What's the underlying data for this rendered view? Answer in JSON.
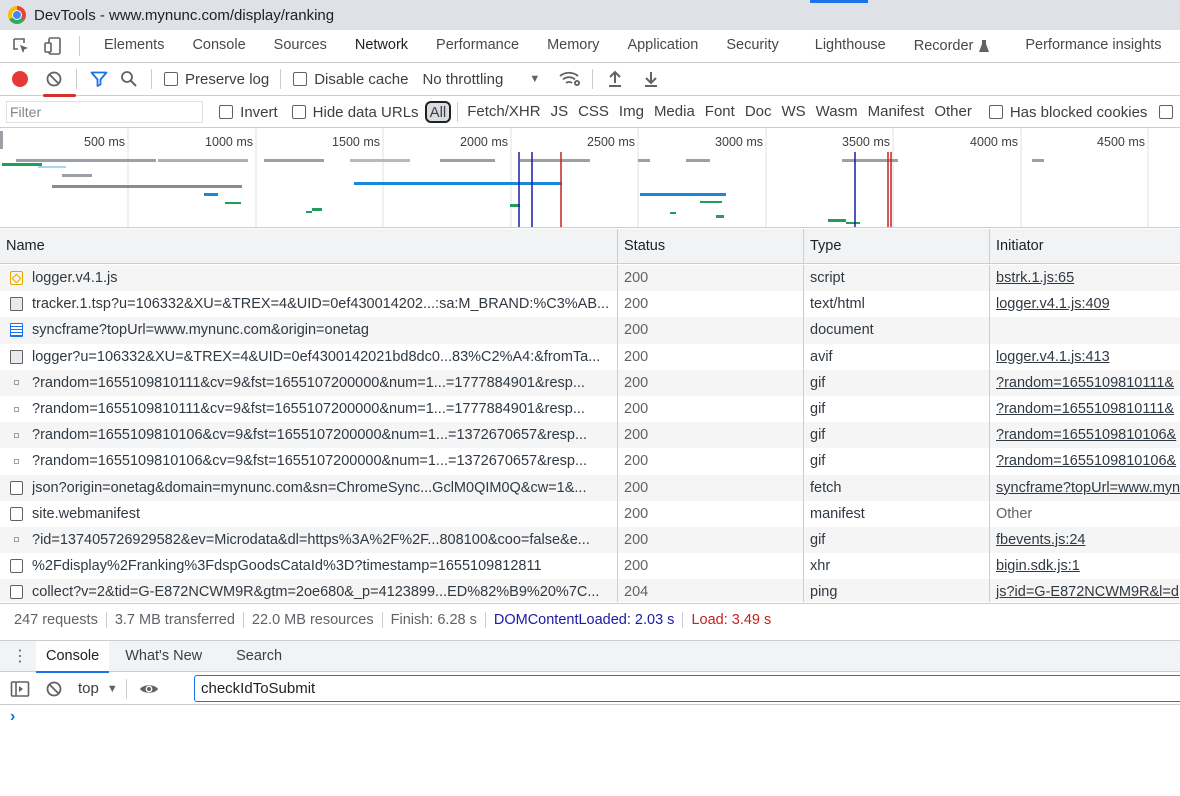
{
  "window": {
    "title": "DevTools - www.mynunc.com/display/ranking"
  },
  "tabs": [
    "Elements",
    "Console",
    "Sources",
    "Network",
    "Performance",
    "Memory",
    "Application",
    "Security",
    "Lighthouse",
    "Recorder",
    "Performance insights"
  ],
  "active_tab": "Network",
  "toolbar": {
    "preserve_log": "Preserve log",
    "disable_cache": "Disable cache",
    "throttling": "No throttling"
  },
  "filterbar": {
    "placeholder": "Filter",
    "invert": "Invert",
    "hide_data_urls": "Hide data URLs",
    "types": [
      "All",
      "Fetch/XHR",
      "JS",
      "CSS",
      "Img",
      "Media",
      "Font",
      "Doc",
      "WS",
      "Wasm",
      "Manifest",
      "Other"
    ],
    "selected_type": "All",
    "has_blocked_cookies": "Has blocked cookies"
  },
  "overview": {
    "ticks": [
      "500 ms",
      "1000 ms",
      "1500 ms",
      "2000 ms",
      "2500 ms",
      "3000 ms",
      "3500 ms",
      "4000 ms",
      "4500 ms"
    ]
  },
  "columns": {
    "name": "Name",
    "status": "Status",
    "type": "Type",
    "initiator": "Initiator"
  },
  "requests": [
    {
      "icon": "script",
      "name": "logger.v4.1.js",
      "status": "200",
      "type": "script",
      "initiator": "bstrk.1.js:65",
      "init_link": true
    },
    {
      "icon": "img",
      "name": "tracker.1.tsp?u=106332&XU=&TREX=4&UID=0ef430014202...:sa:M_BRAND:%C3%AB...",
      "status": "200",
      "type": "text/html",
      "initiator": "logger.v4.1.js:409",
      "init_link": true
    },
    {
      "icon": "doc",
      "name": "syncframe?topUrl=www.mynunc.com&origin=onetag",
      "status": "200",
      "type": "document",
      "initiator": "",
      "init_link": false
    },
    {
      "icon": "img",
      "name": "logger?u=106332&XU=&TREX=4&UID=0ef4300142021bd8dc0...83%C2%A4:&fromTa...",
      "status": "200",
      "type": "avif",
      "initiator": "logger.v4.1.js:413",
      "init_link": true
    },
    {
      "icon": "small",
      "name": "?random=1655109810111&cv=9&fst=1655107200000&num=1...=1777884901&resp...",
      "status": "200",
      "type": "gif",
      "initiator": "?random=1655109810111&",
      "init_link": true
    },
    {
      "icon": "small",
      "name": "?random=1655109810111&cv=9&fst=1655107200000&num=1...=1777884901&resp...",
      "status": "200",
      "type": "gif",
      "initiator": "?random=1655109810111&",
      "init_link": true
    },
    {
      "icon": "small",
      "name": "?random=1655109810106&cv=9&fst=1655107200000&num=1...=1372670657&resp...",
      "status": "200",
      "type": "gif",
      "initiator": "?random=1655109810106&",
      "init_link": true
    },
    {
      "icon": "small",
      "name": "?random=1655109810106&cv=9&fst=1655107200000&num=1...=1372670657&resp...",
      "status": "200",
      "type": "gif",
      "initiator": "?random=1655109810106&",
      "init_link": true
    },
    {
      "icon": "generic",
      "name": "json?origin=onetag&domain=mynunc.com&sn=ChromeSync...GclM0QIM0Q&cw=1&...",
      "status": "200",
      "type": "fetch",
      "initiator": "syncframe?topUrl=www.myn",
      "init_link": true
    },
    {
      "icon": "generic",
      "name": "site.webmanifest",
      "status": "200",
      "type": "manifest",
      "initiator": "Other",
      "init_link": false
    },
    {
      "icon": "small",
      "name": "?id=137405726929582&ev=Microdata&dl=https%3A%2F%2F...808100&coo=false&e...",
      "status": "200",
      "type": "gif",
      "initiator": "fbevents.js:24",
      "init_link": true
    },
    {
      "icon": "generic",
      "name": "%2Fdisplay%2Franking%3FdspGoodsCataId%3D?timestamp=1655109812811",
      "status": "200",
      "type": "xhr",
      "initiator": "bigin.sdk.js:1",
      "init_link": true
    },
    {
      "icon": "generic",
      "name": "collect?v=2&tid=G-E872NCWM9R&gtm=2oe680&_p=4123899...ED%82%B9%20%7C...",
      "status": "204",
      "type": "ping",
      "initiator": "js?id=G-E872NCWM9R&l=d",
      "init_link": true
    }
  ],
  "summary": {
    "requests": "247 requests",
    "transferred": "3.7 MB transferred",
    "resources": "22.0 MB resources",
    "finish": "Finish: 6.28 s",
    "dom": "DOMContentLoaded: 2.03 s",
    "load": "Load: 3.49 s"
  },
  "drawer": {
    "tabs": [
      "Console",
      "What's New",
      "Search"
    ],
    "active": "Console",
    "context": "top",
    "input_value": "checkIdToSubmit"
  },
  "colors": {
    "accent": "#1a73e8",
    "record": "#e53935",
    "dom_line": "#1a1aa6",
    "load_line": "#c5221f"
  }
}
